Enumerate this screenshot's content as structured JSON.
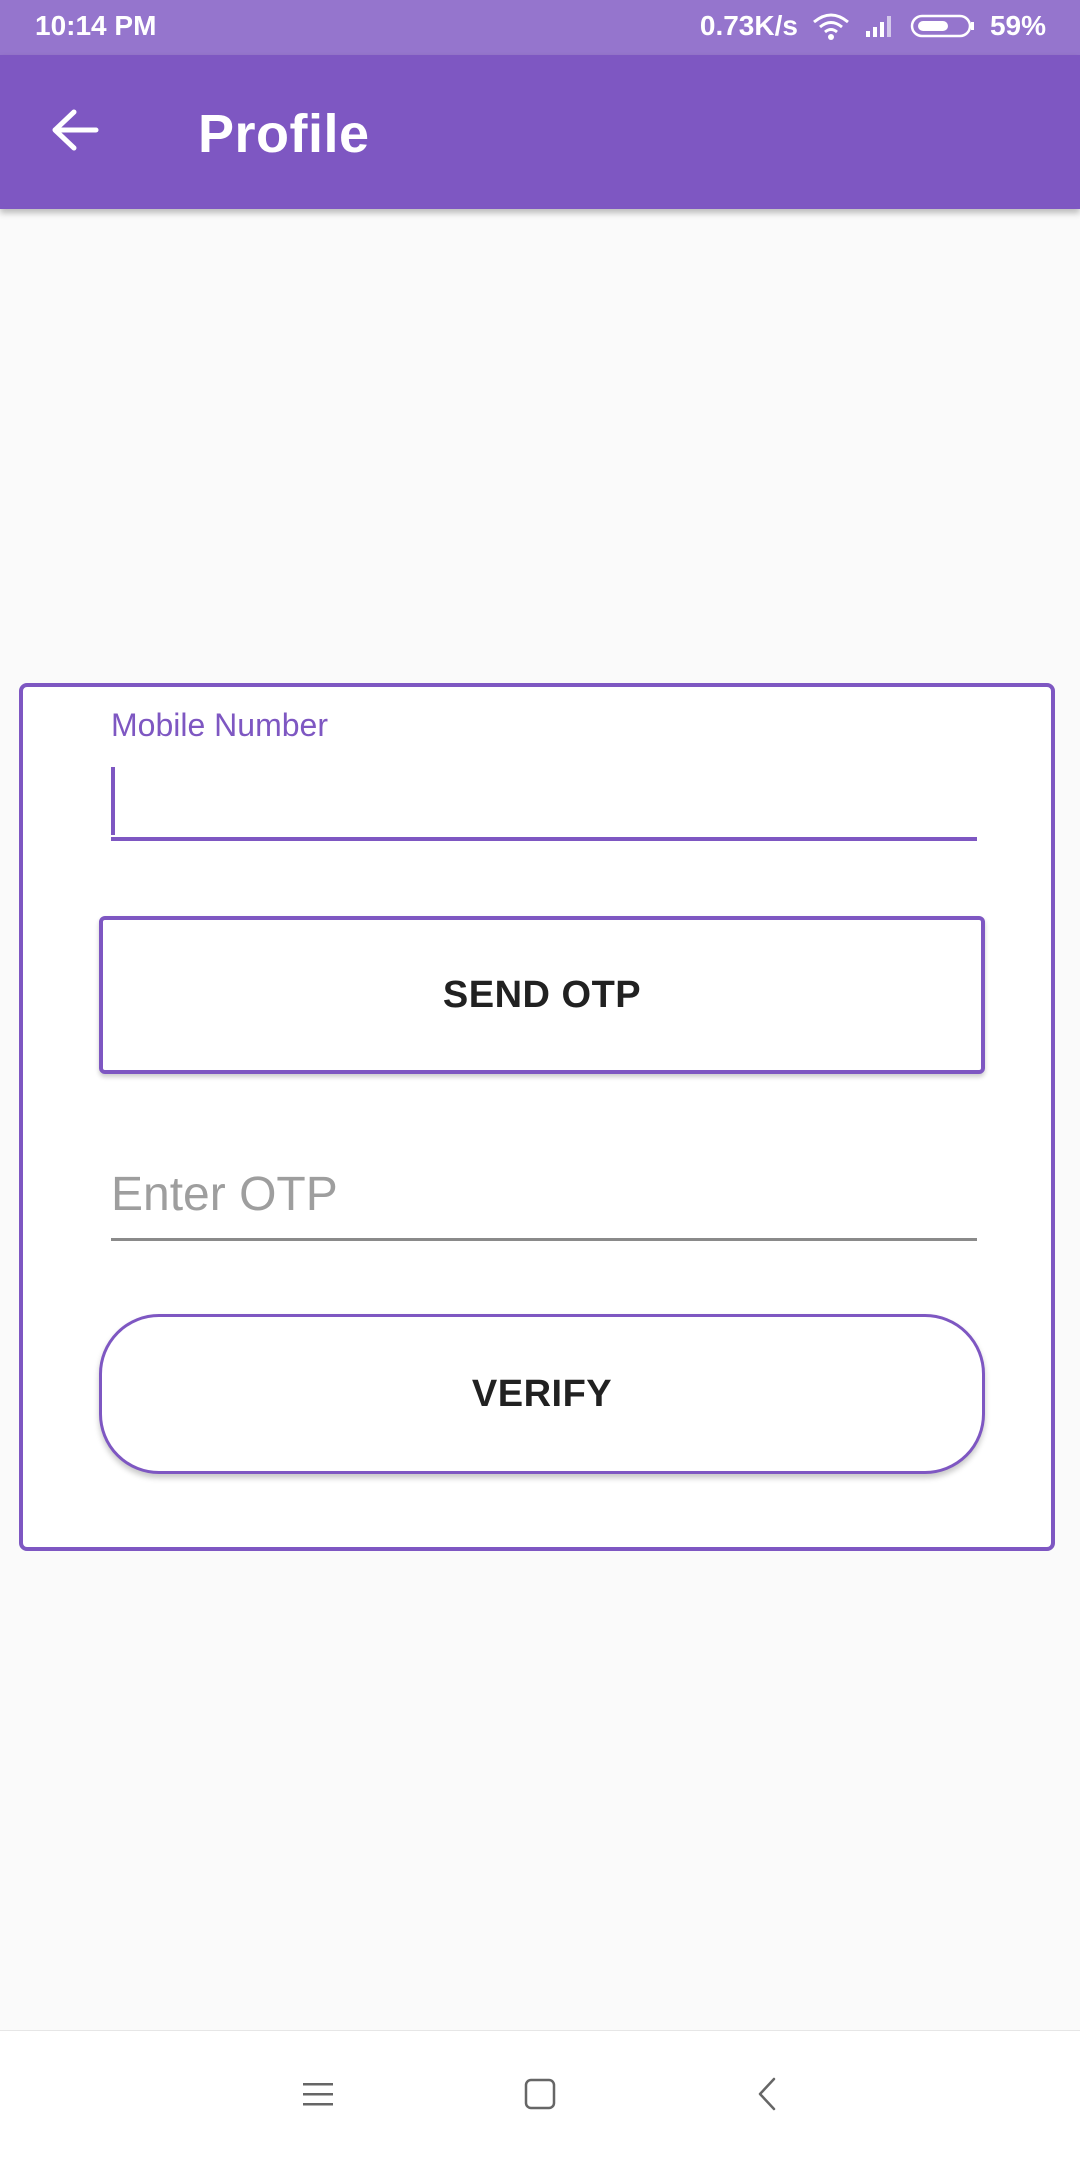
{
  "status_bar": {
    "time": "10:14 PM",
    "network_speed": "0.73K/s",
    "battery": "59%",
    "battery_level": 0.59,
    "icons": [
      "wifi-icon",
      "signal-icon",
      "battery-icon"
    ]
  },
  "app_bar": {
    "title": "Profile",
    "back_icon": "arrow-left-icon"
  },
  "form": {
    "mobile_label": "Mobile Number",
    "mobile_value": "",
    "send_otp_label": "SEND OTP",
    "otp_placeholder": "Enter OTP",
    "otp_value": "",
    "verify_label": "VERIFY"
  },
  "nav_bar": {
    "icons": [
      "menu-icon",
      "home-square-icon",
      "back-chevron-icon"
    ]
  },
  "colors": {
    "primary": "#7e57c2",
    "status_bar": "#9575cd",
    "background": "#fafafa",
    "text": "#212121",
    "hint": "#9e9e9e"
  }
}
